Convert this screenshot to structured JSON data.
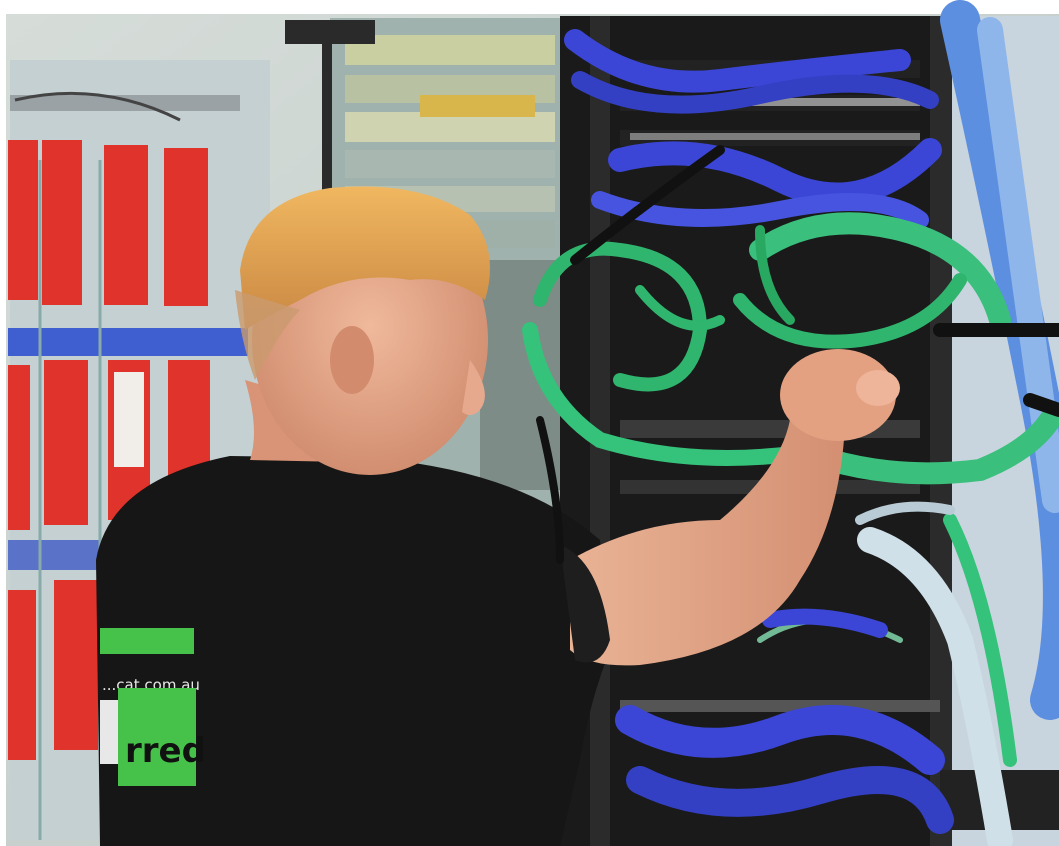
{
  "photo": {
    "shirt_print_top": "...cat.com.au",
    "shirt_print_logo": "rred"
  },
  "colors": {
    "wall": "#cfd8d4",
    "panel_red": "#e0332b",
    "cable_blue": "#3b46d6",
    "cable_green": "#2fb56d",
    "shirt": "#161616",
    "skin": "#e8a888",
    "hair": "#d99a4e",
    "rack": "#1a1a1a",
    "logo_green": "#46c24a"
  }
}
